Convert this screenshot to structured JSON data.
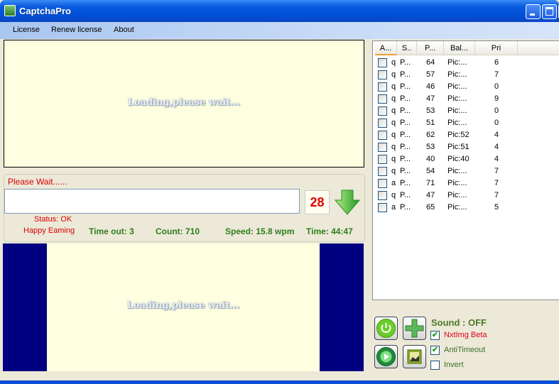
{
  "window": {
    "title": "CaptchaPro"
  },
  "menu": [
    "License",
    "Renew license",
    "About"
  ],
  "captcha": {
    "loading_text": "Loading,please wait...",
    "status_message": "Please Wait......",
    "answer_value": "",
    "countdown": "28",
    "status": "Status: OK",
    "greeting": "Happy Eaming",
    "timeout": "Time out: 3",
    "count": "Count: 710",
    "speed": "Speed: 15.8 wpm",
    "time": "Time: 44:47"
  },
  "preview": {
    "loading_text": "Loading,please wait..."
  },
  "list": {
    "columns": [
      "A...",
      "S..",
      "P...",
      "Bal...",
      "Pri"
    ],
    "rows": [
      [
        "q",
        "P...",
        "64",
        "Pic:...",
        "6"
      ],
      [
        "q",
        "P...",
        "57",
        "Pic:...",
        "7"
      ],
      [
        "q",
        "P...",
        "46",
        "Pic:...",
        "0"
      ],
      [
        "q",
        "P...",
        "47",
        "Pic:...",
        "9"
      ],
      [
        "q",
        "P...",
        "53",
        "Pic:...",
        "0"
      ],
      [
        "q",
        "P...",
        "51",
        "Pic:...",
        "0"
      ],
      [
        "q",
        "P...",
        "62",
        "Pic:52",
        "4"
      ],
      [
        "q",
        "P...",
        "53",
        "Pic:51",
        "4"
      ],
      [
        "q",
        "P...",
        "40",
        "Pic:40",
        "4"
      ],
      [
        "q",
        "P...",
        "54",
        "Pic:...",
        "7"
      ],
      [
        "a",
        "P...",
        "71",
        "Pic:...",
        "7"
      ],
      [
        "q",
        "P...",
        "47",
        "Pic:...",
        "7"
      ],
      [
        "a",
        "P...",
        "65",
        "Pic:...",
        "5"
      ]
    ]
  },
  "controls": {
    "sound": "Sound : OFF",
    "options": [
      {
        "label": "NxtImg Beta",
        "checked": true,
        "color": "#e0001b"
      },
      {
        "label": "AntiTimeout",
        "checked": true,
        "color": "#3c6e2a"
      },
      {
        "label": "Invert",
        "checked": false,
        "color": "#3c6e2a"
      }
    ]
  }
}
